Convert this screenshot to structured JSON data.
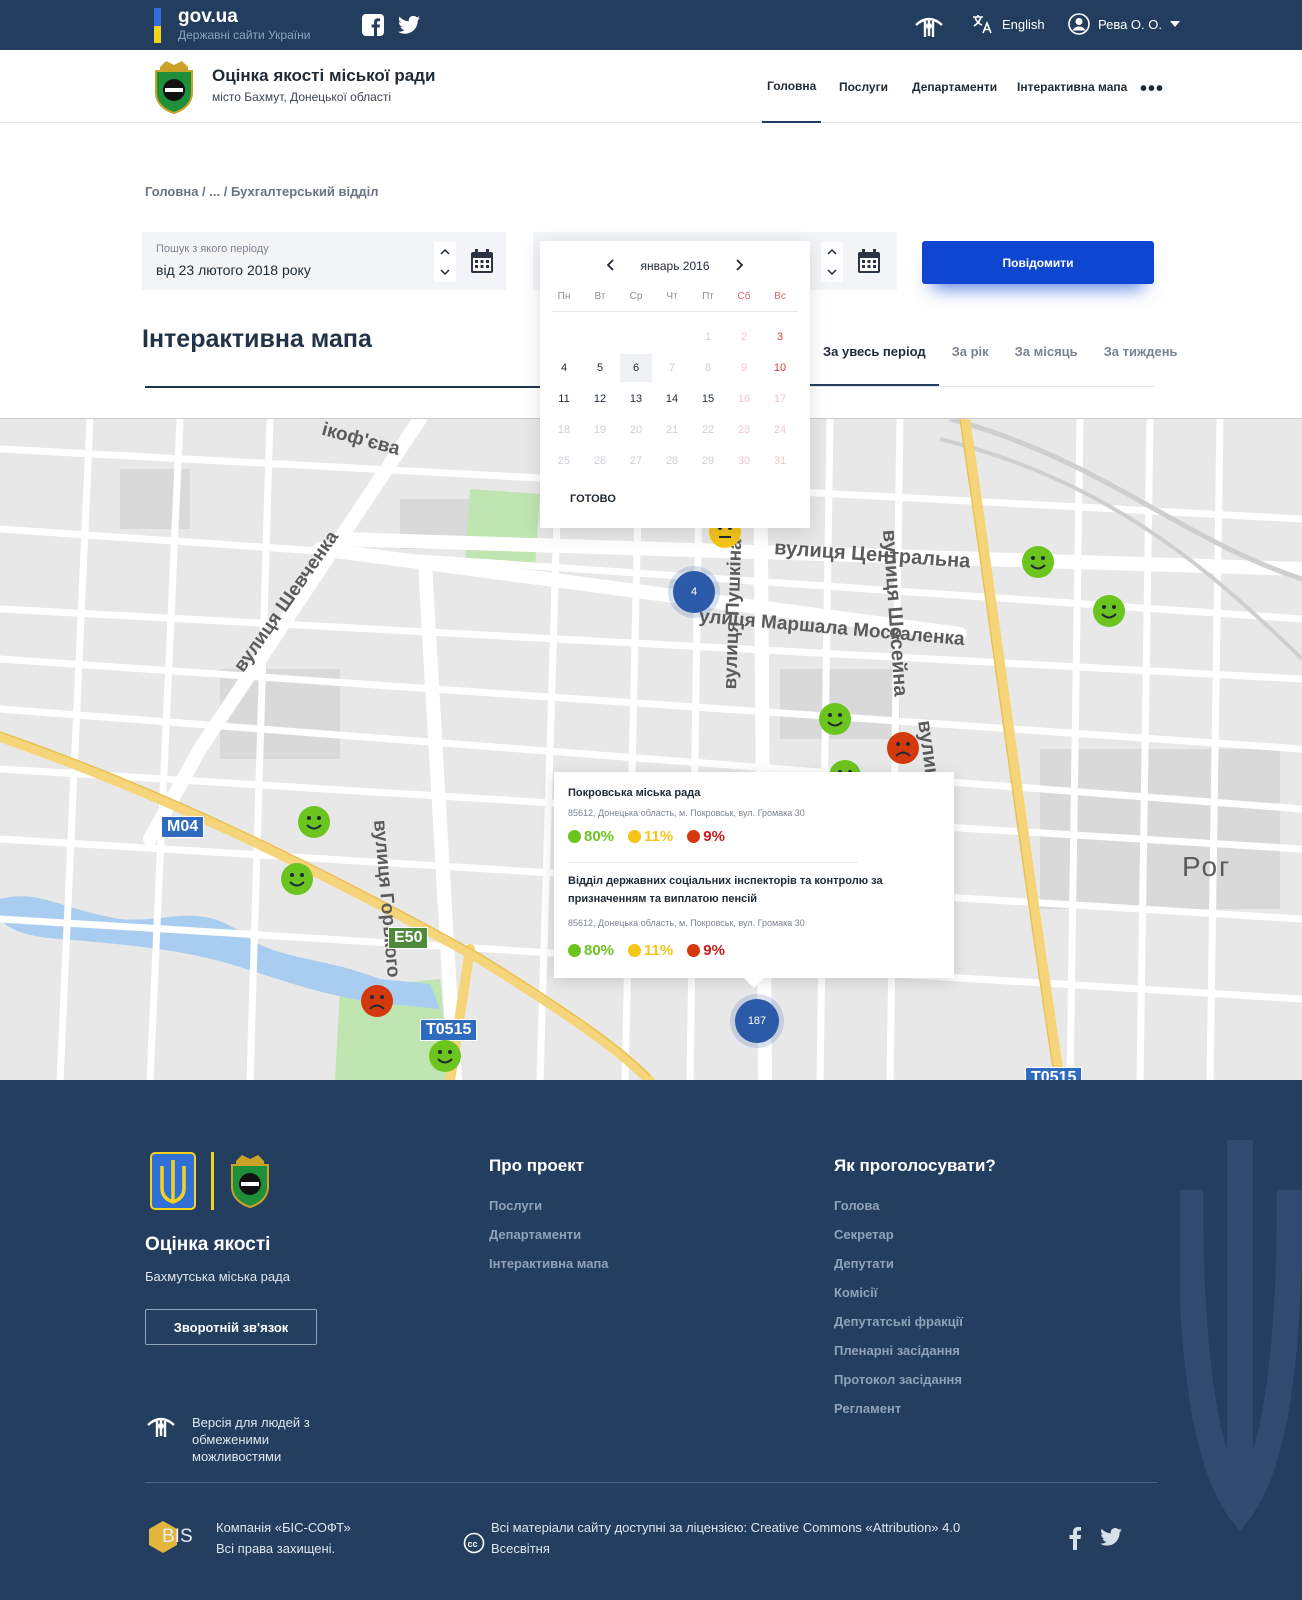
{
  "topbar": {
    "gov_name": "gov.ua",
    "gov_sub": "Державні сайти України",
    "lang": "English",
    "user": "Рева О. О."
  },
  "header": {
    "title": "Оцінка якості міської ради",
    "subtitle": "місто Бахмут, Донецької області",
    "nav": [
      {
        "label": "Головна"
      },
      {
        "label": "Послуги"
      },
      {
        "label": "Департаменти"
      },
      {
        "label": "Інтерактивна мапа"
      }
    ],
    "more": "•••"
  },
  "breadcrumb": "Головна / ... / Бухгалтерський відділ",
  "filter": {
    "from_label": "Пошук з якого періоду",
    "from_value": "від 23 лютого 2018 року"
  },
  "report_button": "Повідомити",
  "map_title": "Інтерактивна мапа",
  "tabs": [
    {
      "label": "За увесь період"
    },
    {
      "label": "За рік"
    },
    {
      "label": "За місяць"
    },
    {
      "label": "За тиждень"
    }
  ],
  "calendar": {
    "month": "январь 2016",
    "done": "ГОТОВО",
    "dow": [
      "Пн",
      "Вт",
      "Ср",
      "Чт",
      "Пт",
      "Сб",
      "Вс"
    ],
    "weeks": [
      [
        "",
        "",
        "",
        "",
        "1",
        "2",
        "3"
      ],
      [
        "4",
        "5",
        "6",
        "7",
        "8",
        "9",
        "10"
      ],
      [
        "11",
        "12",
        "13",
        "14",
        "15",
        "16",
        "17"
      ],
      [
        "18",
        "19",
        "20",
        "21",
        "22",
        "23",
        "24"
      ],
      [
        "25",
        "26",
        "27",
        "28",
        "29",
        "30",
        "31"
      ]
    ],
    "selected": "6"
  },
  "map": {
    "streets": [
      "вулиця Центральна",
      "улиця Маршала Москаленка",
      "вулиця Шевченка",
      "вулиця Пушкіна",
      "вулиця Горького",
      "вулиця Шосейна",
      "вулиця Шосейна",
      "ікоф'єва",
      "Рог"
    ],
    "roads": [
      "M04",
      "E50",
      "T0515",
      "T0515"
    ],
    "clusters": [
      "4",
      "187"
    ]
  },
  "popup": {
    "items": [
      {
        "name": "Покровська міська рада",
        "address": "85612, Донецька область,  м. Покровськ, вул. Громака 30",
        "good": "80%",
        "neutral": "11%",
        "bad": "9%"
      },
      {
        "name": "Відділ державних соціальних інспекторів та контролю за призначенням та виплатою пенсій",
        "address": "85612, Донецька область,  м. Покровськ, вул. Громака 30",
        "good": "80%",
        "neutral": "11%",
        "bad": "9%"
      }
    ]
  },
  "footer": {
    "title": "Оцінка якості",
    "subtitle": "Бахмутська міська рада",
    "feedback": "Зворотній зв'язок",
    "about_title": "Про проект",
    "about_links": [
      "Послуги",
      "Департаменти",
      "Інтерактивна мапа"
    ],
    "vote_title": "Як проголосувати?",
    "vote_links": [
      "Голова",
      "Секретар",
      "Депутати",
      "Комісії",
      "Депутатські фракції",
      "Пленарні засідання",
      "Протокол засідання",
      "Регламент"
    ],
    "accessibility": [
      "Версія для людей з",
      "обмеженими",
      "можливостями"
    ],
    "company": [
      "Компанія «БІС-СОФТ»",
      "Всі права захищені."
    ],
    "license": [
      "Всі матеріали сайту доступні за ліцензією: Creative Commons «Attribution» 4.0",
      "Всесвітня"
    ],
    "bis_logo": "BIS"
  },
  "colors": {
    "navy": "#223d5e",
    "blue": "#0e45d1",
    "good": "#6cc51f",
    "neutral": "#f5c518",
    "bad": "#d4380d"
  }
}
